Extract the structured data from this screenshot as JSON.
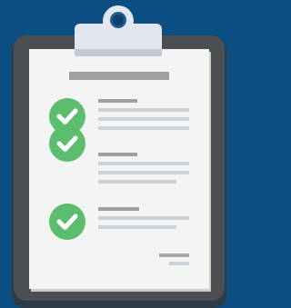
{
  "illustration": {
    "subject": "clipboard-checklist",
    "checked_items": 3,
    "colors": {
      "background": "#0c4e82",
      "board": "#4c4f52",
      "paper": "#f3f4f4",
      "check": "#5cbd6e",
      "clip": "#e3e6ee"
    },
    "icons": [
      "clip-icon",
      "check-icon"
    ]
  }
}
